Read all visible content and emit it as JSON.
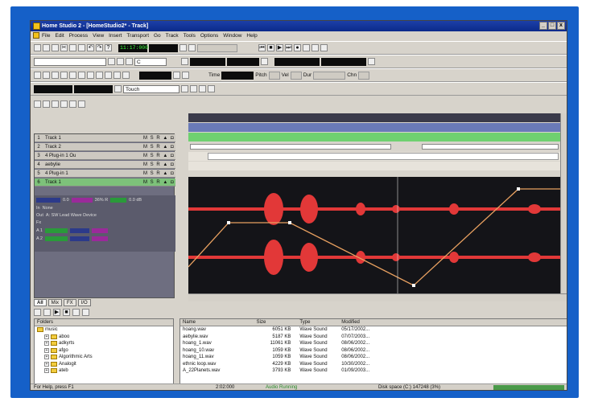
{
  "window": {
    "title": "Home Studio 2 - [HomeStudio2* - Track]",
    "controls": [
      "_",
      "□",
      "x"
    ]
  },
  "menu": [
    "File",
    "Edit",
    "Process",
    "View",
    "Insert",
    "Transport",
    "Go",
    "Track",
    "Tools",
    "Options",
    "Window",
    "Help"
  ],
  "toolbar1": {
    "now_time": "11:17:000"
  },
  "toolbar2": {
    "tempo_combo": "C"
  },
  "toolbar3": {
    "time_label": "Time",
    "pitch_label": "Pitch",
    "vel_label": "Vel",
    "dur_label": "Dur",
    "chn_label": "Chn"
  },
  "toolbar4": {
    "automation_mode": "Touch"
  },
  "tracks": [
    {
      "num": "1",
      "name": "Track 1",
      "flags": "M S R ▲ ◘"
    },
    {
      "num": "2",
      "name": "Track 2",
      "flags": "M S R ▲ ◘"
    },
    {
      "num": "3",
      "name": "4 Plug-in 1 Ou",
      "flags": "M S R ▲ ◘"
    },
    {
      "num": "4",
      "name": "aebylie",
      "flags": "M S R ▲ ◘"
    },
    {
      "num": "5",
      "name": "4 Plug-in 1",
      "flags": "M S R ▲ ◘"
    },
    {
      "num": "6",
      "name": "Track 1",
      "flags": "M S R ▲ ◘"
    }
  ],
  "strip": {
    "in_label": "In",
    "in_value": "None",
    "out_label": "Out",
    "out_value": "A: SW Lead Wave Device",
    "fx_label": "Fx",
    "send1_label": "A 1",
    "send2_label": "A 2",
    "vol": "0.0",
    "pan": "36% R",
    "trim": "0.0 dB"
  },
  "browser_tabs": [
    "All",
    "Mix",
    "FX",
    "I/O"
  ],
  "folders": {
    "header": "Folders",
    "items": [
      {
        "name": "music",
        "indent": 0
      },
      {
        "name": "aboo",
        "indent": 1
      },
      {
        "name": "adkyrts",
        "indent": 1
      },
      {
        "name": "afgo",
        "indent": 1
      },
      {
        "name": "Algorithmic Arts",
        "indent": 1
      },
      {
        "name": "Analogit",
        "indent": 1
      },
      {
        "name": "ateb",
        "indent": 1
      }
    ]
  },
  "files": {
    "columns": [
      "Name",
      "Size",
      "Type",
      "Modified"
    ],
    "rows": [
      [
        "hoang.wav",
        "6051 KB",
        "Wave Sound",
        "05/17/2002..."
      ],
      [
        "aebylie.wav",
        "5187 KB",
        "Wave Sound",
        "07/07/2003..."
      ],
      [
        "hoang_1.wav",
        "11061 KB",
        "Wave Sound",
        "08/06/2002..."
      ],
      [
        "hoang_10.wav",
        "1059 KB",
        "Wave Sound",
        "08/06/2002..."
      ],
      [
        "hoang_11.wav",
        "1059 KB",
        "Wave Sound",
        "08/06/2002..."
      ],
      [
        "ethnic loop.wav",
        "4229 KB",
        "Wave Sound",
        "10/30/2002..."
      ],
      [
        "A_22Planets.wav",
        "3793 KB",
        "Wave Sound",
        "01/09/2003..."
      ]
    ]
  },
  "status": {
    "help": "For Help, press F1",
    "time": "2:02:000",
    "audio": "Audio Running",
    "disk": "Disk space (C:) 147248 (3%)"
  },
  "colors": {
    "frame": "#1560c8",
    "wave": "#e23838",
    "envelope": "#e8a060",
    "clip_green": "#56c85a"
  }
}
